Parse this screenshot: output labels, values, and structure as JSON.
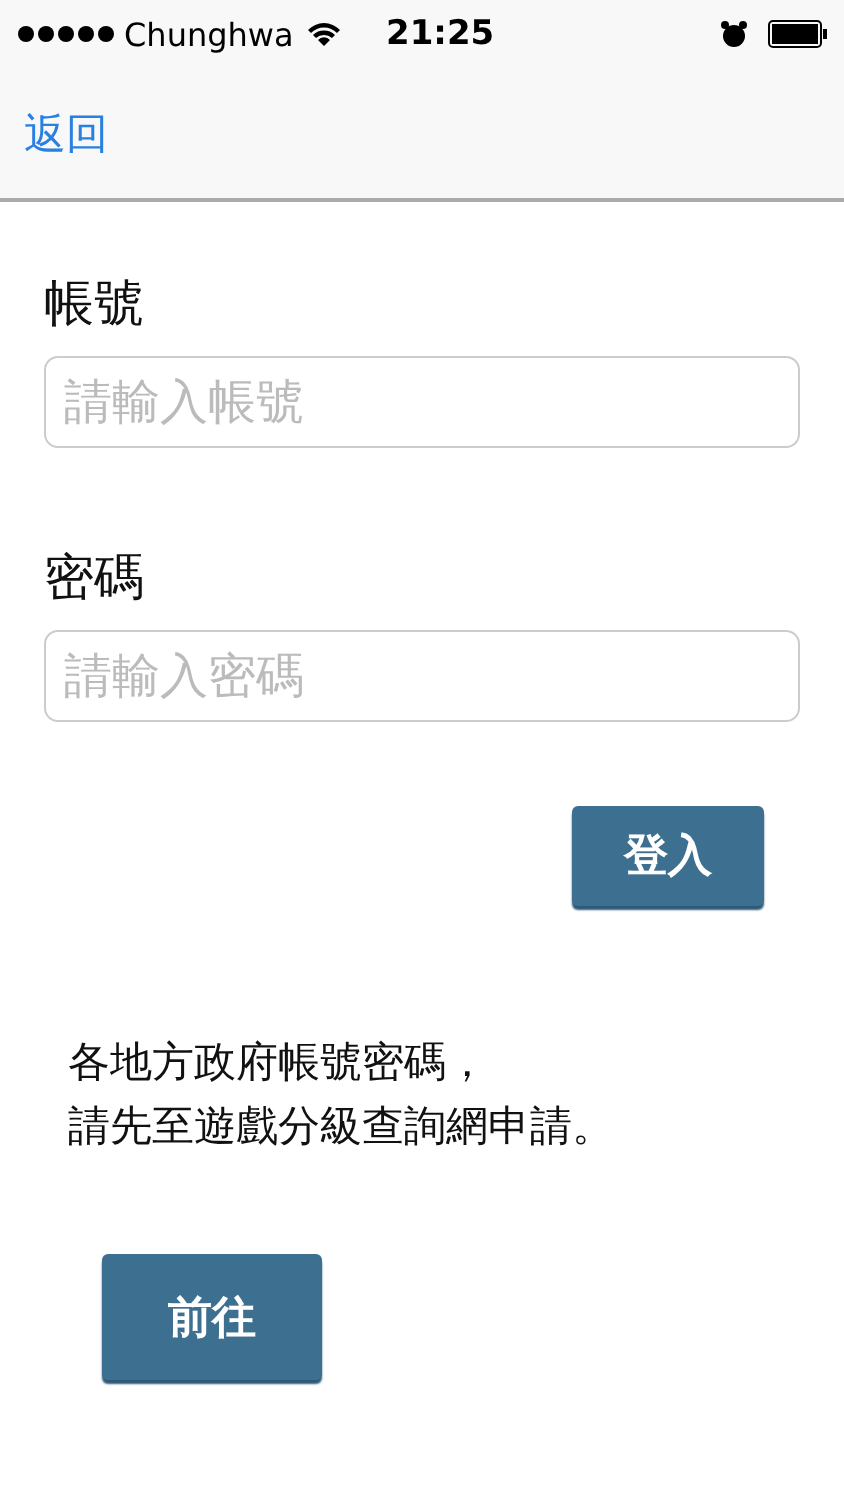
{
  "status_bar": {
    "carrier": "Chunghwa",
    "time": "21:25"
  },
  "nav": {
    "back": "返回"
  },
  "fields": [
    {
      "label": "帳號",
      "placeholder": "請輸入帳號"
    },
    {
      "label": "密碼",
      "placeholder": "請輸入密碼"
    }
  ],
  "login_button": "登入",
  "notice": [
    "各地方政府帳號密碼，",
    "請先至遊戲分級查詢網申請。"
  ],
  "go_button": "前往"
}
